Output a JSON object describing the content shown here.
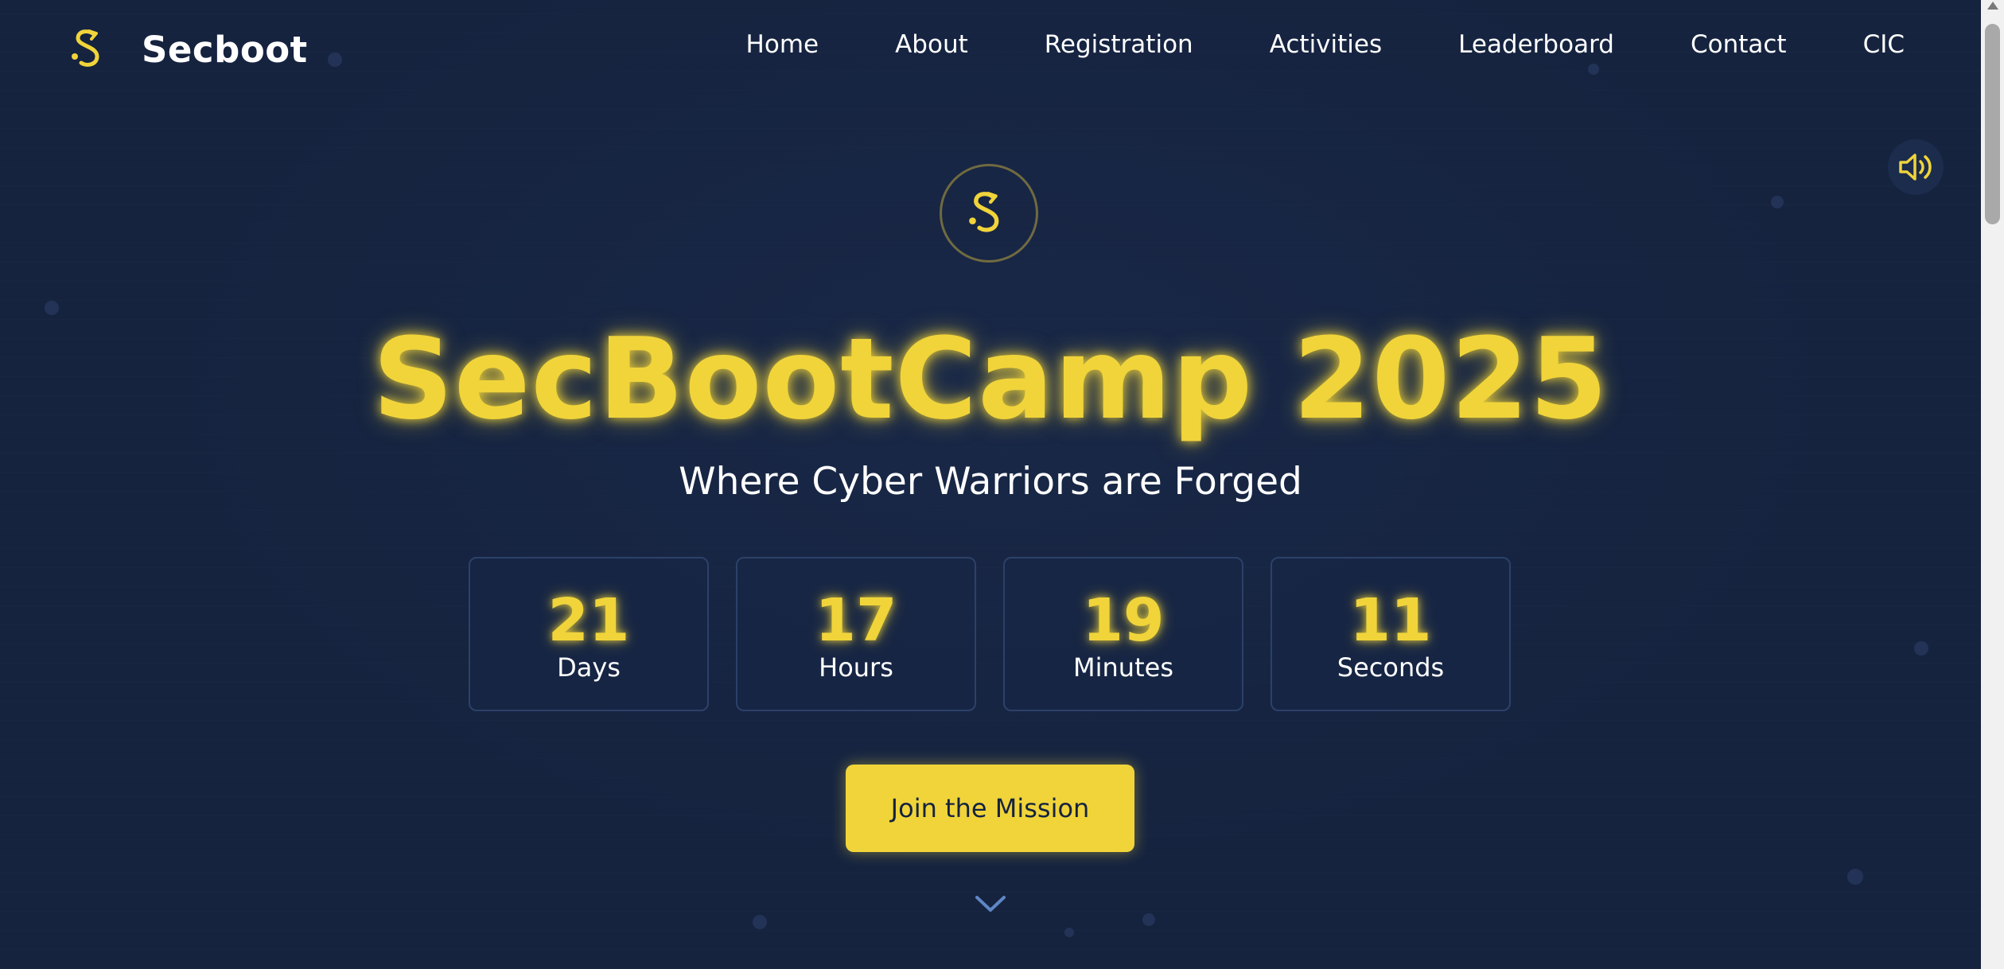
{
  "nav": {
    "brand": "Secboot",
    "links": [
      "Home",
      "About",
      "Registration",
      "Activities",
      "Leaderboard",
      "Contact",
      "CIC"
    ]
  },
  "hero": {
    "title": "SecBootCamp 2025",
    "subtitle": "Where Cyber Warriors are Forged",
    "countdown": [
      {
        "value": "21",
        "label": "Days"
      },
      {
        "value": "17",
        "label": "Hours"
      },
      {
        "value": "19",
        "label": "Minutes"
      },
      {
        "value": "11",
        "label": "Seconds"
      }
    ],
    "cta_label": "Join the Mission"
  },
  "icons": {
    "brand_logo": "secboot-s-logo-icon",
    "hero_logo": "secboot-s-logo-icon",
    "sound": "volume-icon",
    "scroll_down": "chevron-down-icon"
  },
  "colors": {
    "background": "#15233f",
    "accent": "#f0d43a",
    "text": "#ffffff",
    "card_border": "#2c4169"
  }
}
